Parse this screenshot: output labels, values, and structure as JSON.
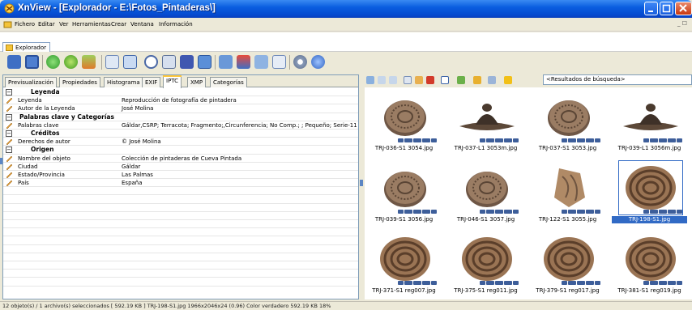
{
  "window": {
    "title": "XnView - [Explorador - E:\\Fotos_Pintaderas\\]"
  },
  "menu": {
    "items": [
      "Fichero",
      "Editar",
      "Ver",
      "Herramientas",
      "Crear",
      "Ventana",
      "Información"
    ],
    "mdi_controls": "_ ☐"
  },
  "doc_tab": {
    "label": "Explorador"
  },
  "toolbar": {
    "icons": [
      "open-icon",
      "fullscreen-icon",
      "refresh-icon",
      "recycle-icon",
      "acquire-icon",
      "print-preview-icon",
      "slideshow-icon",
      "find-icon",
      "print-icon",
      "batch-icon",
      "capture-icon",
      "convert-icon",
      "web-page-icon",
      "contact-sheet-icon",
      "multipage-icon",
      "settings-icon",
      "info-icon"
    ]
  },
  "info_tabs": [
    "Previsualización",
    "Propiedades",
    "Histograma",
    "EXIF",
    "IPTC",
    "XMP",
    "Categorías"
  ],
  "active_info_tab": "IPTC",
  "iptc": {
    "groups": [
      {
        "title": "Leyenda",
        "rows": [
          {
            "key": "Leyenda",
            "value": "Reproducción de fotografía de pintadera"
          },
          {
            "key": "Autor de la Leyenda",
            "value": "José Molina"
          }
        ]
      },
      {
        "title": "Palabras clave y Categorías",
        "rows": [
          {
            "key": "Palabras clave",
            "value": "Gáldar,CSRP; Terracota; Fragmento;,Circunferencia; No Comp.; ; Pequeño; Serie-11"
          }
        ]
      },
      {
        "title": "Créditos",
        "rows": [
          {
            "key": "Derechos de autor",
            "value": "© José Molina"
          }
        ]
      },
      {
        "title": "Origen",
        "rows": [
          {
            "key": "Nombre del objeto",
            "value": "Colección de pintaderas de Cueva Pintada"
          },
          {
            "key": "Ciudad",
            "value": "Gáldar"
          },
          {
            "key": "Estado/Provincia",
            "value": "Las Palmas"
          },
          {
            "key": "País",
            "value": "España"
          }
        ]
      }
    ]
  },
  "browser": {
    "search_text": "<Resultados de búsqueda>"
  },
  "thumbnails": [
    {
      "name": "TRJ-036-S1 3054.jpg",
      "kind": "disc"
    },
    {
      "name": "TRJ-037-L1 3053m.jpg",
      "kind": "cone"
    },
    {
      "name": "TRJ-037-S1 3053.jpg",
      "kind": "disc"
    },
    {
      "name": "TRJ-039-L1 3056m.jpg",
      "kind": "cone"
    },
    {
      "name": "TRJ-039-S1 3056.jpg",
      "kind": "disc"
    },
    {
      "name": "TRJ-046-S1 3057.jpg",
      "kind": "disc"
    },
    {
      "name": "TRJ-122-S1 3055.jpg",
      "kind": "fragment"
    },
    {
      "name": "TRJ-198-S1.jpg",
      "kind": "spiral",
      "selected": true
    },
    {
      "name": "TRJ-371-S1 reg007.jpg",
      "kind": "spiral"
    },
    {
      "name": "TRJ-375-S1 reg011.jpg",
      "kind": "spiral"
    },
    {
      "name": "TRJ-379-S1 reg017.jpg",
      "kind": "spiral"
    },
    {
      "name": "TRJ-381-S1 reg019.jpg",
      "kind": "spiral"
    }
  ],
  "status": {
    "text": "12 objeto(s) / 1 archivo(s) seleccionados  [ 592.19 KB ]   TRJ-198-S1.jpg   1966x2046x24 (0.96)   Color verdadero   592.19 KB   18%"
  },
  "colors": {
    "title_blue": "#0a5ee0",
    "selection": "#316ac5",
    "terracotta": "#8a6a52"
  }
}
